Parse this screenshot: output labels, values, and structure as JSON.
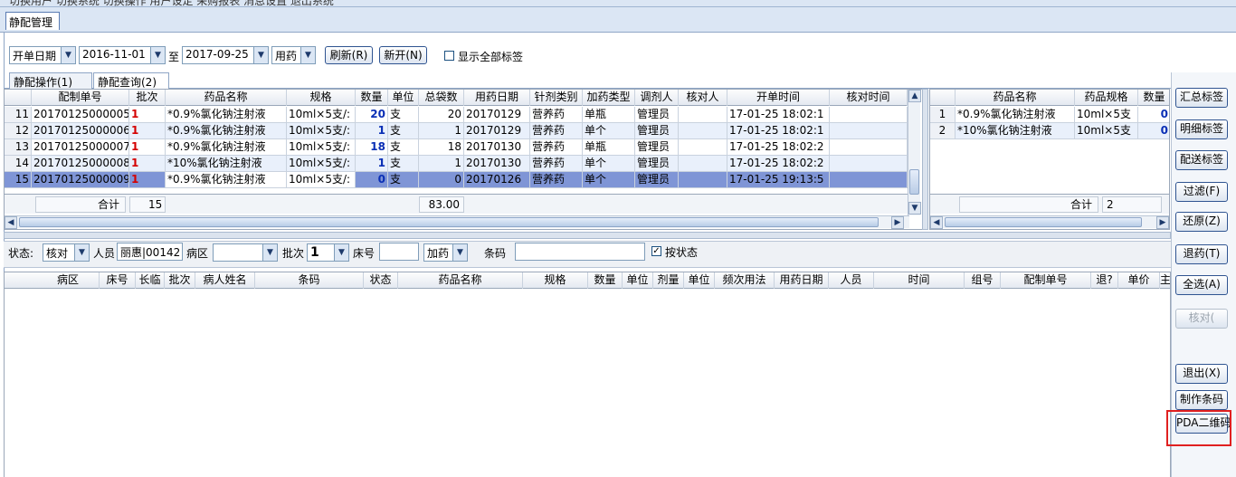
{
  "window": {
    "toolbar_partial": "切换用户  切换系统  切换操作  用户设定  采购报表  消息设置  退出系统",
    "doc_tab": "静配管理"
  },
  "filter": {
    "date_type": "开单日期",
    "date_from": "2016-11-01",
    "to_label": "至",
    "date_to": "2017-09-25",
    "usage": "用药",
    "refresh_button": "刷新(R)",
    "new_button": "新开(N)",
    "show_all_label": "显示全部标签"
  },
  "sub_tabs": [
    "静配操作(1)",
    "静配查询(2)"
  ],
  "main_grid": {
    "headers": [
      "",
      "配制单号",
      "批次",
      "药品名称",
      "规格",
      "数量",
      "单位",
      "总袋数",
      "用药日期",
      "针剂类别",
      "加药类型",
      "调剂人",
      "核对人",
      "开单时间",
      "核对时间"
    ],
    "rows": [
      [
        "11",
        "20170125000005",
        "1",
        "*0.9%氯化钠注射液",
        "10ml×5支/:",
        "20",
        "支",
        "20",
        "20170129",
        "营养药",
        "单瓶",
        "管理员",
        "",
        "17-01-25 18:02:1",
        ""
      ],
      [
        "12",
        "20170125000006",
        "1",
        "*0.9%氯化钠注射液",
        "10ml×5支/:",
        "1",
        "支",
        "1",
        "20170129",
        "营养药",
        "单个",
        "管理员",
        "",
        "17-01-25 18:02:1",
        ""
      ],
      [
        "13",
        "20170125000007",
        "1",
        "*0.9%氯化钠注射液",
        "10ml×5支/:",
        "18",
        "支",
        "18",
        "20170130",
        "营养药",
        "单瓶",
        "管理员",
        "",
        "17-01-25 18:02:2",
        ""
      ],
      [
        "14",
        "20170125000008",
        "1",
        "*10%氯化钠注射液",
        "10ml×5支/:",
        "1",
        "支",
        "1",
        "20170130",
        "营养药",
        "单个",
        "管理员",
        "",
        "17-01-25 18:02:2",
        ""
      ],
      [
        "15",
        "20170125000009",
        "1",
        "*0.9%氯化钠注射液",
        "10ml×5支/:",
        "0",
        "支",
        "0",
        "20170126",
        "营养药",
        "单个",
        "管理员",
        "",
        "17-01-25 19:13:5",
        ""
      ]
    ],
    "selected_row": 4,
    "sum_label": "合计",
    "sum_count": "15",
    "sum_total": "83.00"
  },
  "side_grid": {
    "headers": [
      "",
      "药品名称",
      "药品规格",
      "数量"
    ],
    "rows": [
      [
        "1",
        "*0.9%氯化钠注射液",
        "10ml×5支",
        "0"
      ],
      [
        "2",
        "*10%氯化钠注射液",
        "10ml×5支",
        "0"
      ]
    ],
    "sum_label": "合计",
    "sum_count": "2"
  },
  "status_bar": {
    "status_label": "状态:",
    "status_value": "核对",
    "person_label": "人员",
    "person_value": "丽惠|00142",
    "ward_label": "病区",
    "ward_value": "",
    "batch_label": "批次",
    "batch_value": "1",
    "bed_label": "床号",
    "bed_value": "",
    "add_drug": "加药",
    "barcode_label": "条码",
    "barcode_value": "",
    "by_status_label": "按状态"
  },
  "detail_grid": {
    "headers": [
      "病区",
      "床号",
      "长临",
      "批次",
      "病人姓名",
      "条码",
      "状态",
      "药品名称",
      "规格",
      "数量",
      "单位",
      "剂量",
      "单位",
      "频次用法",
      "用药日期",
      "人员",
      "时间",
      "组号",
      "配制单号",
      "退?",
      "单价",
      "主"
    ]
  },
  "side_buttons": {
    "summary": "汇总标签",
    "detail": "明细标签",
    "delivery": "配送标签",
    "filter": "过滤(F)",
    "restore": "还原(Z)",
    "return": "退药(T)",
    "select_all": "全选(A)",
    "verify": "核对(",
    "exit": "退出(X)",
    "make_barcode": "制作条码",
    "pda_qr": "PDA二维码"
  }
}
